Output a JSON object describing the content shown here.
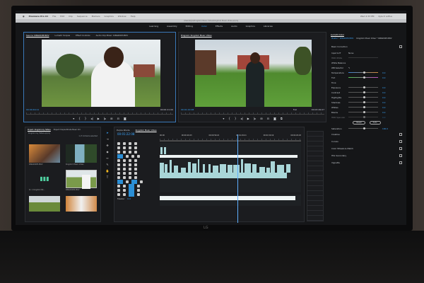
{
  "menubar": {
    "app": "Premiere Pro CC",
    "items": [
      "File",
      "Edit",
      "Clip",
      "Sequence",
      "Markers",
      "Graphics",
      "Window",
      "Help"
    ],
    "clock": "Wed 2:33 PM",
    "user": "Kyle P. Loftus"
  },
  "titlebar": "/Users/kyle/Kingdom Music Video/Kingdom Music Video.prproj",
  "workspaces": {
    "items": [
      "Learning",
      "Assembly",
      "Editing",
      "Color",
      "Effects",
      "Audio",
      "Graphics",
      "Libraries"
    ],
    "active": "Color"
  },
  "source": {
    "tabs": [
      "Source: KINGDOM.MOV",
      "Lumetri Scopes",
      "Effect Controls",
      "Audio Clip Mixer: KINGDOM.MOV"
    ],
    "timecode": "00:00:49:11",
    "duration": "00:00:21:00"
  },
  "program": {
    "tab": "Program: Kingdom Music Video",
    "timecode": "00:01:22:08",
    "fit": "Full",
    "duration": "00:03:49:07"
  },
  "lumetri": {
    "tab": "Lumetri Color",
    "clip": "Master * KINGDOM.MOV",
    "sequence": "Kingdom Music Video * KINGDOM.MOV",
    "basic": "Basic Correction",
    "input_lut_label": "Input LUT",
    "input_lut": "None",
    "hdr_white": "HDR White",
    "white_balance": "White Balance",
    "wb_selector": "WB Selector",
    "wb_sliders": [
      {
        "label": "Temperature",
        "value": "0.0"
      },
      {
        "label": "Tint",
        "value": "0.0"
      }
    ],
    "tone": "Tone",
    "tone_sliders": [
      {
        "label": "Exposure",
        "value": "0.0"
      },
      {
        "label": "Contrast",
        "value": "0.0"
      },
      {
        "label": "Highlights",
        "value": "0.0"
      },
      {
        "label": "Shadows",
        "value": "0.0"
      },
      {
        "label": "Whites",
        "value": "0.0"
      },
      {
        "label": "Blacks",
        "value": "0.0"
      },
      {
        "label": "HDR Specular",
        "value": "0.0"
      }
    ],
    "reset": "Reset",
    "auto": "Auto",
    "saturation_label": "Saturation",
    "saturation": "100.0",
    "sections": [
      "Creative",
      "Curves",
      "Color Wheels & Match",
      "HSL Secondary",
      "Vignette"
    ]
  },
  "project": {
    "tabs": [
      "Project: Kingdom by Hafere",
      "Project: Purple Rhode Music Vid"
    ],
    "file": "Kingdom by Hafere.prproj",
    "selection": "1 of 14 items selected",
    "items": [
      {
        "name": "KINGDOM3.MOV",
        "dur": "0:03:00"
      },
      {
        "name": "Kingdom Music Video",
        "dur": "3:49:07"
      },
      {
        "name": "Kr. 1 Kingdom Bk...",
        "dur": "3:51:00:00"
      },
      {
        "name": "KINGDOM4.MOV",
        "dur": "0:21:00"
      },
      {
        "name": "",
        "dur": ""
      },
      {
        "name": "",
        "dur": ""
      }
    ]
  },
  "timeline": {
    "tabs": [
      "Purple Rhode",
      "Kingdom Music Video"
    ],
    "timecode": "00:01:22:08",
    "ruler": [
      "00:00",
      "00:00:29:23",
      "00:00:59:22",
      "00:01:29:21",
      "00:01:59:19",
      "00:02:29:18"
    ],
    "master": "Master",
    "master_val": "0.0"
  }
}
